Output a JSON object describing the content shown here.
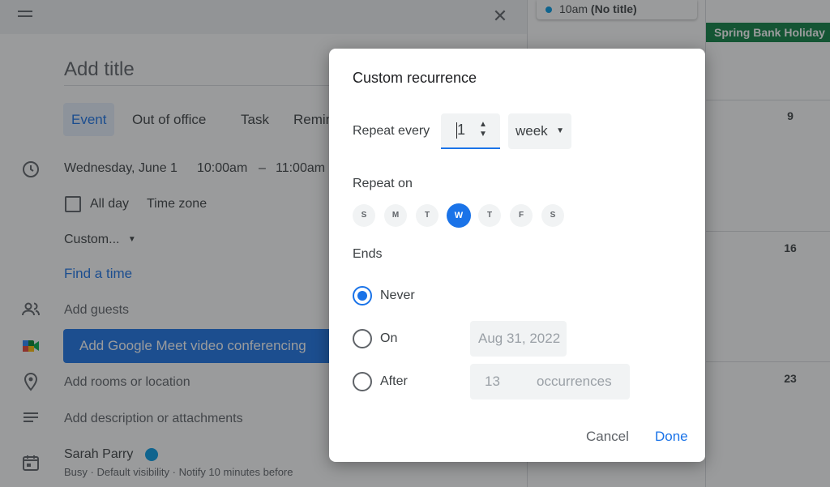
{
  "editor": {
    "title_placeholder": "Add title",
    "tabs": [
      {
        "label": "Event"
      },
      {
        "label": "Out of office"
      },
      {
        "label": "Task"
      },
      {
        "label": "Remin"
      }
    ],
    "date": "Wednesday, June 1",
    "start_time": "10:00am",
    "dash": "–",
    "end_time": "11:00am",
    "all_day_label": "All day",
    "time_zone_label": "Time zone",
    "recurrence_value": "Custom...",
    "find_time_label": "Find a time",
    "add_guests_label": "Add guests",
    "meet_button_label": "Add Google Meet video conferencing",
    "location_label": "Add rooms or location",
    "description_label": "Add description or attachments",
    "owner_name": "Sarah Parry",
    "owner_status": "Busy · Default visibility · Notify 10 minutes before"
  },
  "calendar": {
    "event_time": "10am",
    "event_title": "(No title)",
    "holiday": "Spring Bank Holiday",
    "day_numbers": [
      "9",
      "16",
      "23"
    ]
  },
  "dialog": {
    "title": "Custom recurrence",
    "repeat_every_label": "Repeat every",
    "repeat_every_value": "1",
    "repeat_unit": "week",
    "repeat_on_label": "Repeat on",
    "days": [
      {
        "letter": "S",
        "selected": false
      },
      {
        "letter": "M",
        "selected": false
      },
      {
        "letter": "T",
        "selected": false
      },
      {
        "letter": "W",
        "selected": true
      },
      {
        "letter": "T",
        "selected": false
      },
      {
        "letter": "F",
        "selected": false
      },
      {
        "letter": "S",
        "selected": false
      }
    ],
    "ends_label": "Ends",
    "ends_options": {
      "never": "Never",
      "on": "On",
      "after": "After"
    },
    "ends_selected": "never",
    "on_date": "Aug 31, 2022",
    "after_count": "13",
    "after_unit": "occurrences",
    "cancel_label": "Cancel",
    "done_label": "Done"
  },
  "colors": {
    "accent": "#1a73e8",
    "holiday": "#0b8043",
    "owner_dot": "#039be5"
  }
}
